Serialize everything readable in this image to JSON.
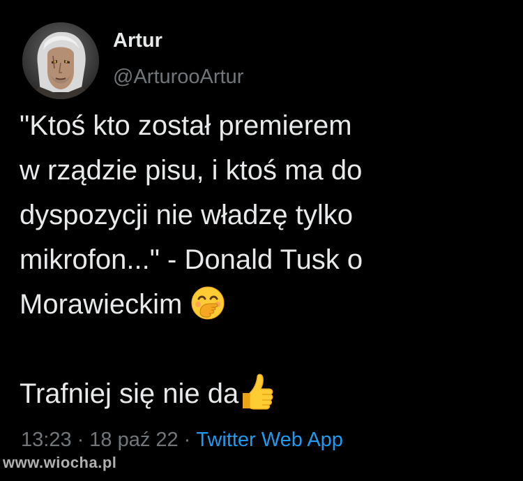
{
  "author": {
    "display_name": "Artur",
    "handle": "@ArturooArtur"
  },
  "tweet": {
    "lines": [
      "\"Ktoś kto został premierem",
      "w rządzie pisu, i ktoś ma do",
      "dyspozycji nie władzę tylko",
      "mikrofon...\" - Donald Tusk o",
      "Morawieckim"
    ],
    "second_paragraph": "Trafniej się nie da",
    "emoji_1": "face-with-hand-over-mouth",
    "emoji_2": "thumbs-up"
  },
  "meta": {
    "time": "13:23",
    "date": "18 paź 22",
    "separator": "·",
    "source": "Twitter Web App"
  },
  "watermark": "www.wiocha.pl",
  "colors": {
    "background": "#000000",
    "text": "#e7e9ea",
    "secondary": "#71767b",
    "link": "#1d9bf0"
  }
}
